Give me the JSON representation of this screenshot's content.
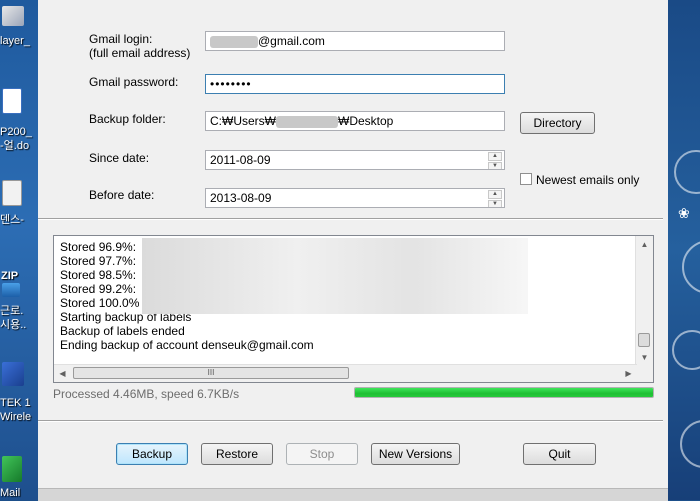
{
  "desktop": {
    "left_labels": [
      "layer_",
      "P200_",
      "-얼.do",
      "덴스-",
      "ZIP",
      "근로.",
      "시용..",
      "TEK 1",
      "Wirele",
      "Mail"
    ]
  },
  "form": {
    "gmail_login_label_line1": "Gmail login:",
    "gmail_login_label_line2": "(full email address)",
    "gmail_login_suffix": "@gmail.com",
    "gmail_password_label": "Gmail password:",
    "gmail_password_value": "••••••••",
    "backup_folder_label": "Backup folder:",
    "backup_folder_prefix": "C:₩Users₩",
    "backup_folder_suffix": "₩Desktop",
    "directory_button": "Directory",
    "since_date_label": "Since date:",
    "since_date_value": "2011-08-09",
    "before_date_label": "Before date:",
    "before_date_value": "2013-08-09",
    "newest_emails_label": "Newest emails only",
    "newest_emails_checked": false
  },
  "log": {
    "lines": [
      "Stored 96.9%:",
      "Stored 97.7%:",
      "Stored 98.5%:",
      "Stored 99.2%:",
      "Stored 100.0%",
      "Starting backup of labels",
      "Backup of labels ended",
      "Ending backup of account denseuk@gmail.com"
    ],
    "hscroll_grip": "III"
  },
  "status": {
    "processed_text": "Processed 4.46MB, speed 6.7KB/s",
    "progress_fraction": 1.0,
    "progress_color": "#1fbf34"
  },
  "buttons": {
    "backup": "Backup",
    "restore": "Restore",
    "stop": "Stop",
    "new_versions": "New Versions",
    "quit": "Quit"
  },
  "icons": {
    "spin_up": "▲",
    "spin_down": "▼",
    "scroll_up": "▲",
    "scroll_down": "▼",
    "scroll_left": "◀",
    "scroll_right": "▶"
  }
}
